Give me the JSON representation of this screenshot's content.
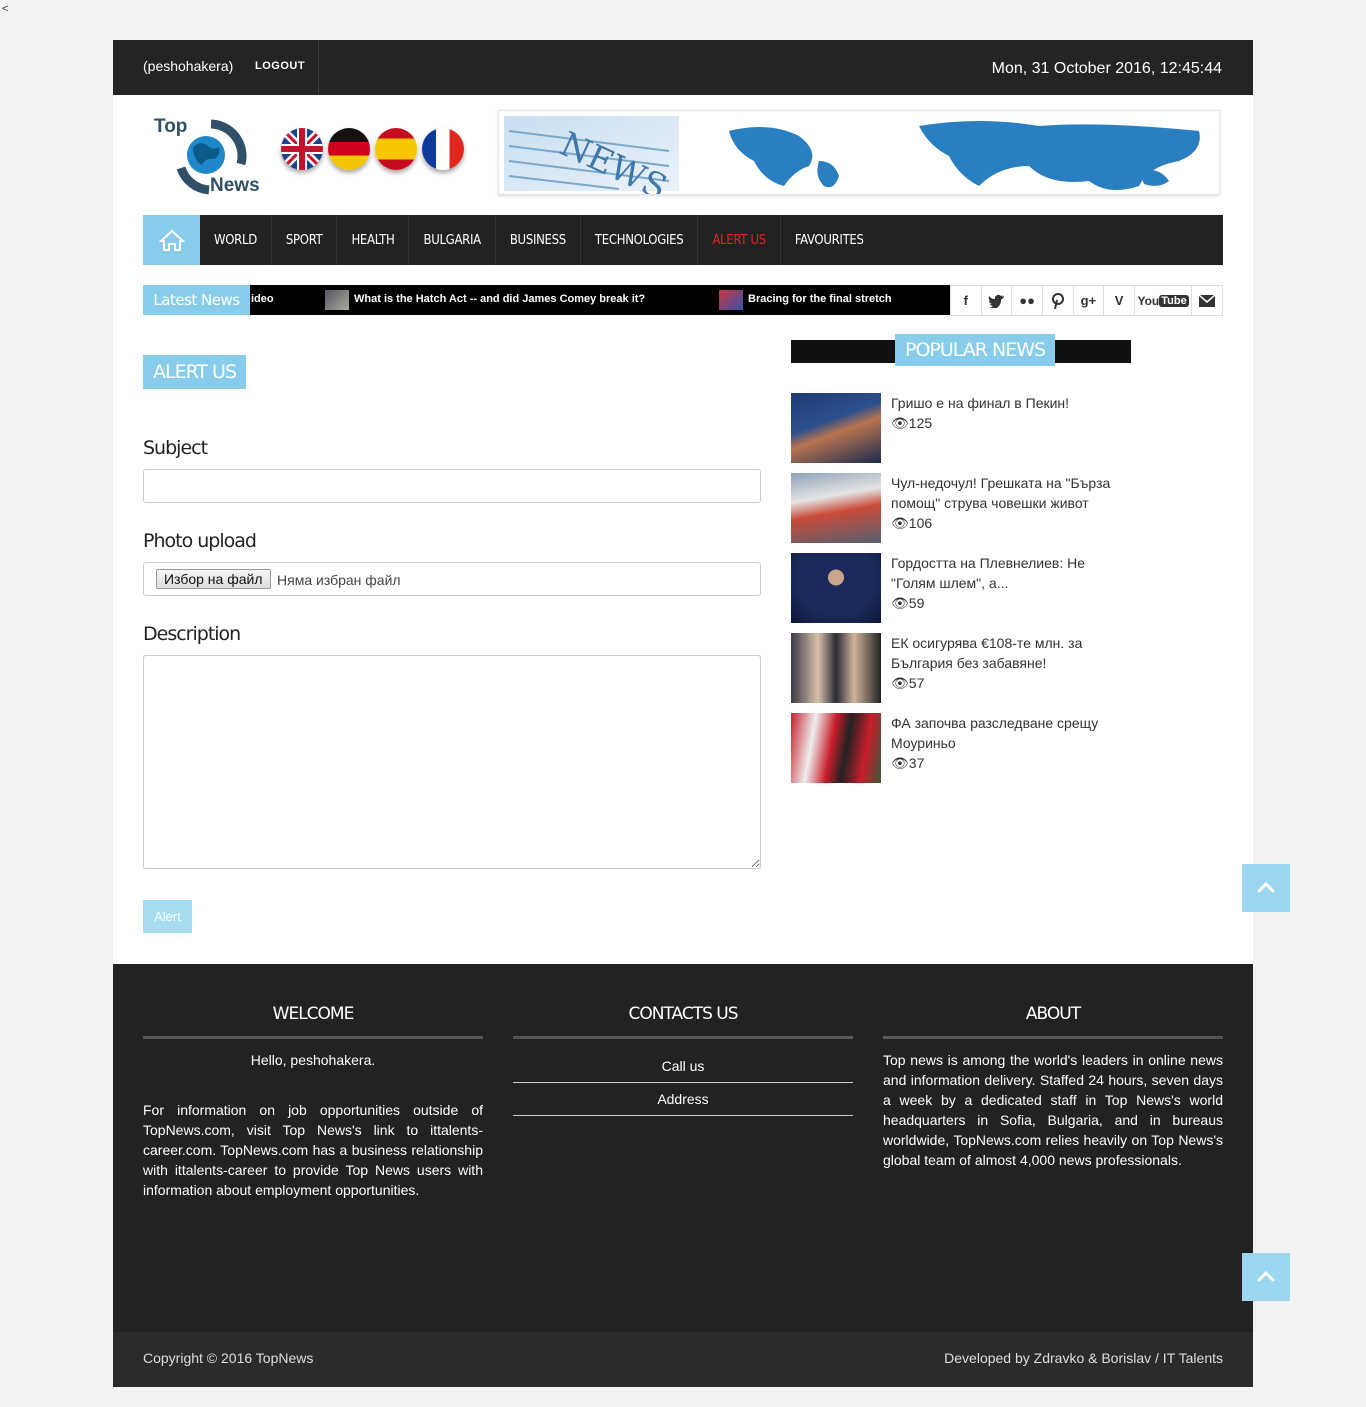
{
  "stray_char": "<",
  "topbar": {
    "username": "(peshohakera)",
    "logout_label": "LOGOUT",
    "datetime": "Mon, 31 October 2016, 12:45:44"
  },
  "logo": {
    "top": "Top",
    "bottom": "News"
  },
  "flags": [
    "uk-flag",
    "germany-flag",
    "spain-flag",
    "france-flag"
  ],
  "nav": {
    "items": [
      "WORLD",
      "SPORT",
      "HEALTH",
      "BULGARIA",
      "BUSINESS",
      "TECHNOLOGIES",
      "ALERT US",
      "FAVOURITES"
    ],
    "active": "ALERT US"
  },
  "ticker": {
    "label": "Latest News",
    "items": [
      "ideo",
      "What is the Hatch Act -- and did James Comey break it?",
      "Bracing for the final stretch"
    ]
  },
  "social": [
    "facebook-icon",
    "twitter-icon",
    "flickr-icon",
    "pinterest-icon",
    "googleplus-icon",
    "vimeo-icon",
    "youtube-icon",
    "mail-icon"
  ],
  "social_youtube": "YouTube",
  "form": {
    "title": "ALERT US",
    "subject_label": "Subject",
    "photo_label": "Photo upload",
    "file_button": "Избор на файл",
    "file_status": "Няма избран файл",
    "description_label": "Description",
    "submit_label": "Alert"
  },
  "popular": {
    "title": "POPULAR NEWS",
    "items": [
      {
        "title": "Гришо е на финал в Пекин!",
        "views": "125"
      },
      {
        "title": "Чул-недочул! Грешката на \"Бърза помощ\" струва човешки живот",
        "views": "106"
      },
      {
        "title": "Гордостта на Плевнелиев: Не \"Голям шлем\", а...",
        "views": "59"
      },
      {
        "title": "ЕК осигурява €108-те млн. за България без забавяне!",
        "views": "57"
      },
      {
        "title": "ФА започва разследване срещу Моуриньо",
        "views": "37"
      }
    ]
  },
  "footer": {
    "welcome_title": "WELCOME",
    "welcome_greeting": "Hello, peshohakera.",
    "welcome_text": "For information on job opportunities outside of TopNews.com, visit Top News's link to ittalents-career.com. TopNews.com has a business relationship with ittalents-career to provide Top News users with information about employment opportunities.",
    "contacts_title": "CONTACTS US",
    "contacts": [
      "Call us",
      "Address"
    ],
    "about_title": "ABOUT",
    "about_text": "Top news is among the world's leaders in online news and information delivery. Staffed 24 hours, seven days a week by a dedicated staff in Top News's world headquarters in Sofia, Bulgaria, and in bureaus worldwide, TopNews.com relies heavily on Top News's global team of almost 4,000 news professionals.",
    "copyright": "Copyright © 2016 TopNews",
    "developed": "Developed by Zdravko & Borislav / IT Talents"
  },
  "colors": {
    "accent": "#87cdeb",
    "dark": "#222222",
    "active_nav": "#e4231e"
  }
}
